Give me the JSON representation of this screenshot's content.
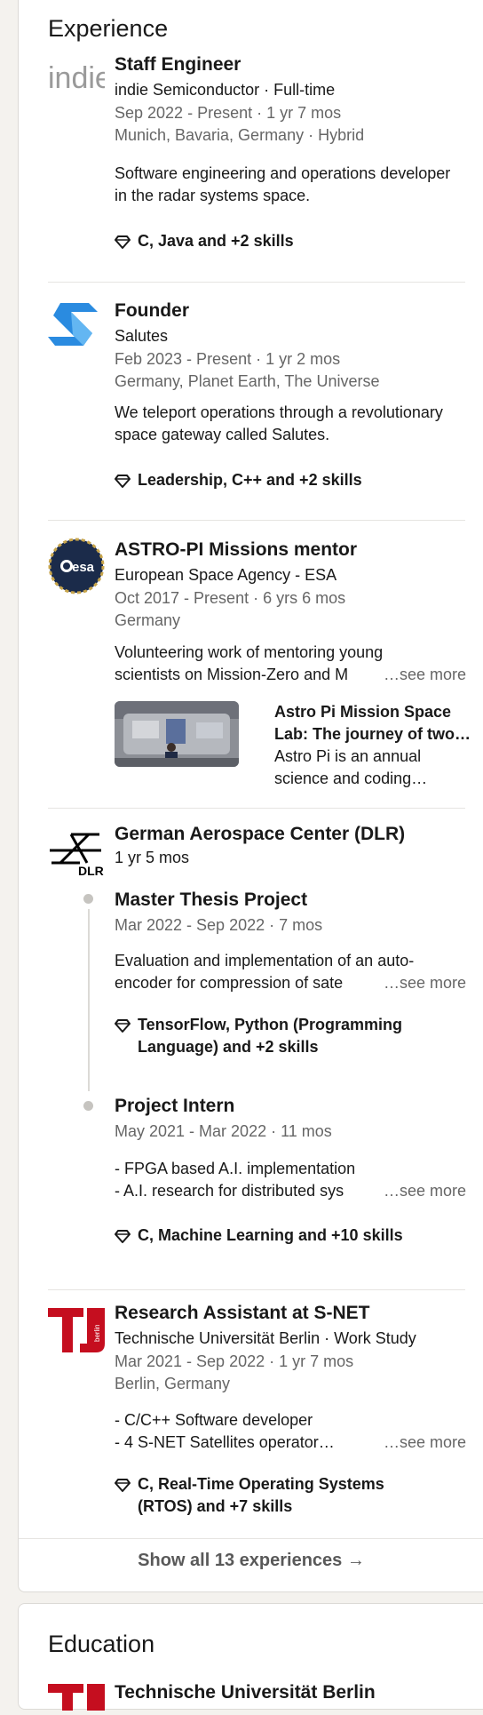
{
  "experience": {
    "title": "Experience",
    "entries": [
      {
        "logo_text": "indie",
        "title": "Staff Engineer",
        "company": "indie Semiconductor · Full-time",
        "dates": "Sep 2022 - Present · 1 yr 7 mos",
        "location": "Munich, Bavaria, Germany · Hybrid",
        "description": "Software engineering and operations developer in the radar systems space.",
        "skills": "C, Java and +2 skills"
      },
      {
        "logo_text": "",
        "title": "Founder",
        "company": "Salutes",
        "dates": "Feb 2023 - Present · 1 yr 2 mos",
        "location": "Germany, Planet Earth, The Universe",
        "description": "We teleport operations through a revolutionary space gateway called Salutes.",
        "skills": "Leadership, C++ and +2 skills"
      },
      {
        "logo_text": "esa",
        "title": "ASTRO-PI Missions mentor",
        "company": "European Space Agency - ESA",
        "dates": "Oct 2017 - Present · 6 yrs 6 mos",
        "location": "Germany",
        "description_line1": "Volunteering work of mentoring young",
        "description_line2": "scientists on Mission-Zero and M",
        "see_more": "…see more",
        "media": {
          "title_line1": "Astro Pi Mission Space",
          "title_line2": "Lab: The journey of two…",
          "desc_line1": "Astro Pi is an annual",
          "desc_line2": "science and coding…"
        }
      },
      {
        "logo_text": "DLR",
        "company": "German Aerospace Center (DLR)",
        "duration": "1 yr 5 mos",
        "roles": [
          {
            "title": "Master Thesis Project",
            "dates": "Mar 2022 - Sep 2022 · 7 mos",
            "description_line1": "Evaluation and implementation of an auto-",
            "description_line2": "encoder for compression of sate",
            "see_more": "…see more",
            "skills_line1": "TensorFlow, Python (Programming",
            "skills_line2": "Language) and +2 skills"
          },
          {
            "title": "Project Intern",
            "dates": "May 2021 - Mar 2022 · 11 mos",
            "description_line1": "- FPGA based A.I. implementation",
            "description_line2": "- A.I. research for distributed sys",
            "see_more": "…see more",
            "skills": "C, Machine Learning and +10 skills"
          }
        ]
      },
      {
        "logo_text": "berlin",
        "title": "Research Assistant at S-NET",
        "company": "Technische Universität Berlin · Work Study",
        "dates": "Mar 2021 - Sep 2022 · 1 yr 7 mos",
        "location": "Berlin, Germany",
        "description_line1": "- C/C++ Software developer",
        "description_line2": "- 4 S-NET Satellites operator…",
        "see_more": "…see more",
        "skills_line1": "C, Real-Time Operating Systems",
        "skills_line2": "(RTOS) and +7 skills"
      }
    ],
    "show_all": "Show all 13 experiences →"
  },
  "education": {
    "title": "Education",
    "first_entry": "Technische Universität Berlin"
  },
  "colors": {
    "background": "#f4f2ee",
    "card": "#ffffff",
    "text": "#191919",
    "muted": "#666666",
    "tu_red": "#c50e1f",
    "salutes_blue": "#2a8be0"
  }
}
